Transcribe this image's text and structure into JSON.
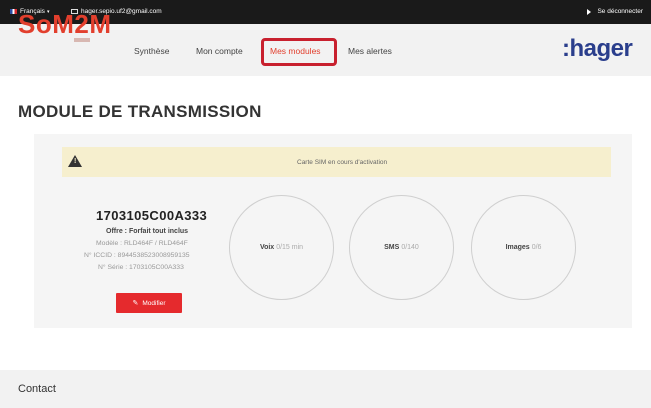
{
  "topbar": {
    "language": "Français",
    "email": "hager.sepio.uf2@gmail.com",
    "logout": "Se déconnecter"
  },
  "nav": {
    "logo": "SoM2M",
    "items": [
      {
        "label": "Synthèse"
      },
      {
        "label": "Mon compte"
      },
      {
        "label": "Mes modules"
      },
      {
        "label": "Mes alertes"
      }
    ],
    "brand": ":hager"
  },
  "page": {
    "title": "MODULE DE TRANSMISSION"
  },
  "alert": {
    "icon": "warning-icon",
    "text": "Carte SIM en cours d'activation"
  },
  "module": {
    "id": "1703105C00A333",
    "offre": "Offre : Forfait tout inclus",
    "modele": "Modèle : RLD464F / RLD464F",
    "iccid": "N° ICCID : 8944538523008959135",
    "serie": "N° Série : 1703105C00A333",
    "modify_button": "Modifier"
  },
  "usage": [
    {
      "label": "Voix",
      "value": "0/15 min"
    },
    {
      "label": "SMS",
      "value": "0/140"
    },
    {
      "label": "Images",
      "value": "0/6"
    }
  ],
  "footer": {
    "contact": "Contact"
  },
  "colors": {
    "brand_red": "#e23f2d",
    "hager_blue": "#2a3e8c",
    "highlight": "#c8202e",
    "button_red": "#e52a2d"
  }
}
